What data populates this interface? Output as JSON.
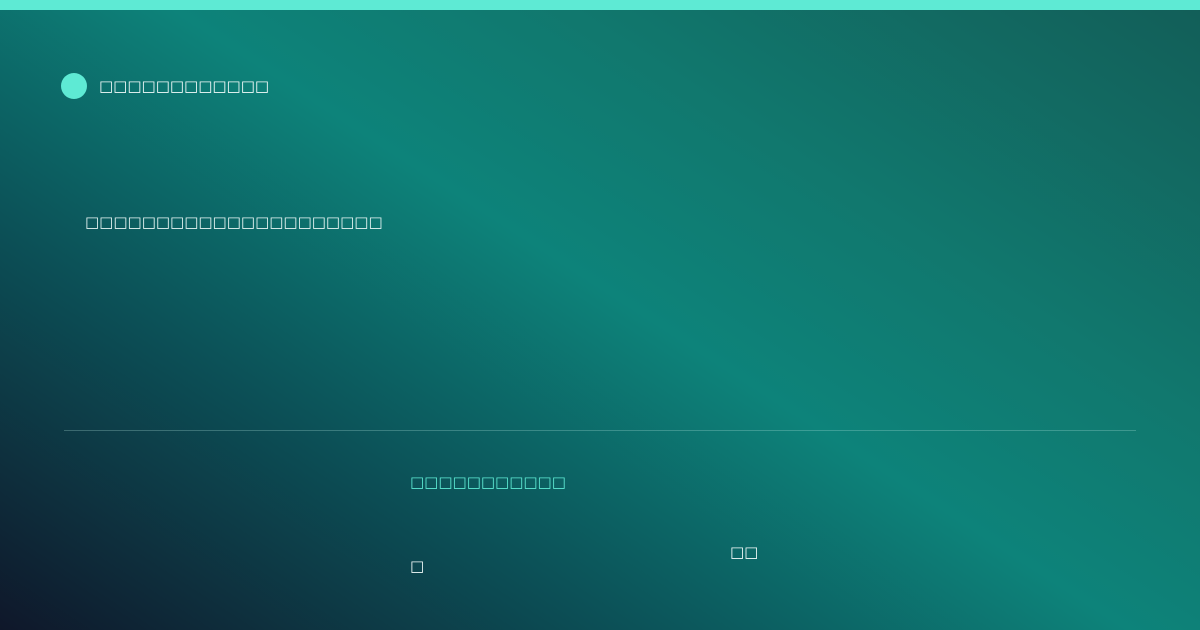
{
  "colors": {
    "accent": "#5eead4",
    "text": "#f3fbfa"
  },
  "brand": {
    "name": "□□□□□□□□□□□□",
    "icon": "dot-icon"
  },
  "headline": "□□□□□□□□□□□□□□□□□□□□□",
  "footer": {
    "label": "□□□□□□□□□□□",
    "value": "□",
    "side": "□□"
  }
}
